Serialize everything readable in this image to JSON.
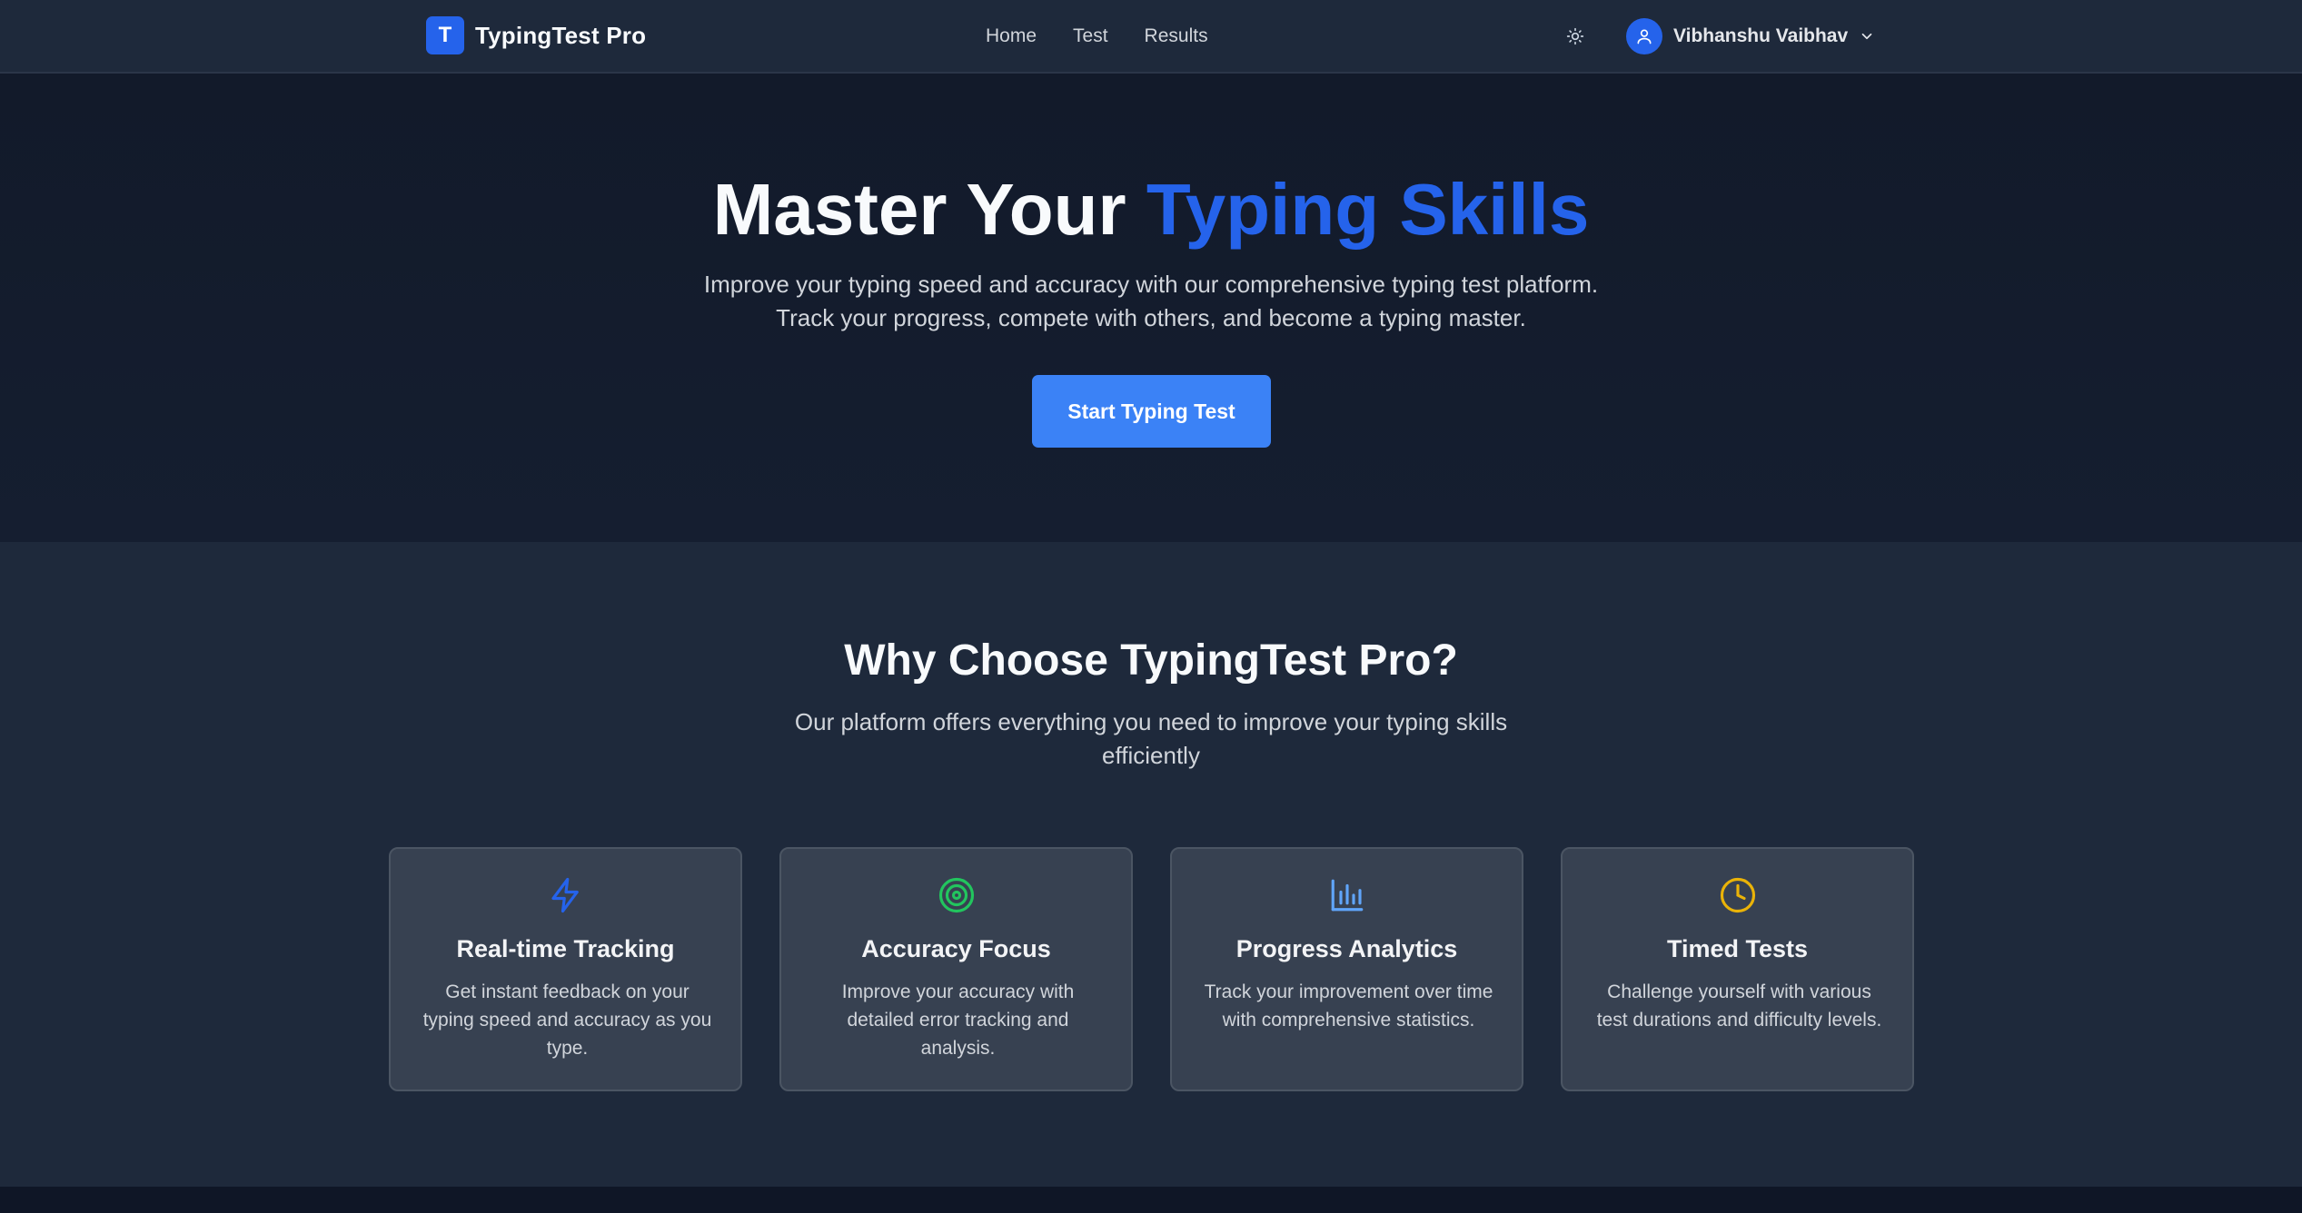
{
  "nav": {
    "brand_letter": "T",
    "brand_name": "TypingTest Pro",
    "links": [
      "Home",
      "Test",
      "Results"
    ],
    "theme_icon": "sun-icon",
    "user_name": "Vibhanshu Vaibhav"
  },
  "hero": {
    "title_plain": "Master Your ",
    "title_accent": "Typing Skills",
    "subtitle_line1": "Improve your typing speed and accuracy with our comprehensive typing test platform.",
    "subtitle_line2": "Track your progress, compete with others, and become a typing master.",
    "cta_label": "Start Typing Test"
  },
  "features": {
    "title": "Why Choose TypingTest Pro?",
    "subtitle": "Our platform offers everything you need to improve your typing skills efficiently",
    "cards": [
      {
        "icon": "lightning-icon",
        "title": "Real-time Tracking",
        "desc": "Get instant feedback on your typing speed and accuracy as you type."
      },
      {
        "icon": "target-icon",
        "title": "Accuracy Focus",
        "desc": "Improve your accuracy with detailed error tracking and analysis."
      },
      {
        "icon": "bar-chart-icon",
        "title": "Progress Analytics",
        "desc": "Track your improvement over time with comprehensive statistics."
      },
      {
        "icon": "clock-icon",
        "title": "Timed Tests",
        "desc": "Challenge yourself with various test durations and difficulty levels."
      }
    ]
  },
  "colors": {
    "accent": "#2563eb",
    "button": "#3b82f6",
    "icon_blue": "#2563eb",
    "icon_green": "#22c55e",
    "icon_lightblue": "#60a5fa",
    "icon_yellow": "#eab308"
  }
}
